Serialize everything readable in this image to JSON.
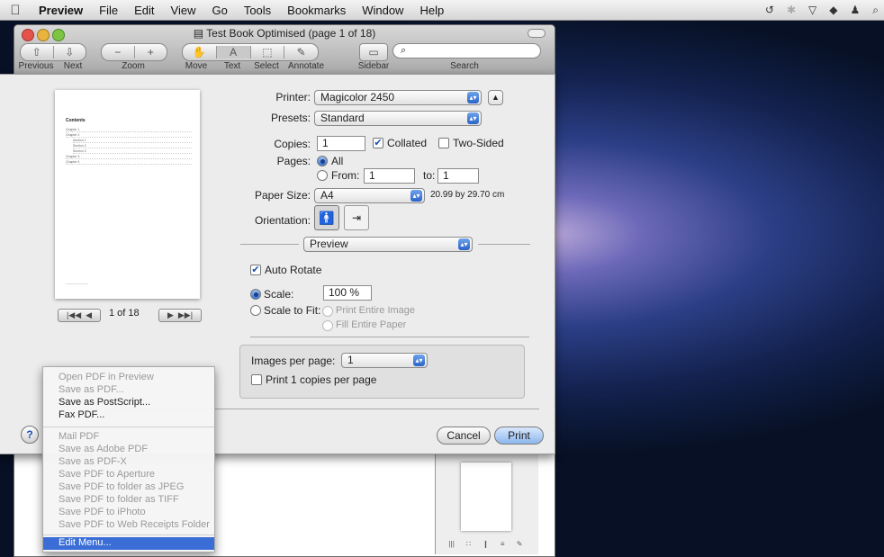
{
  "menubar": {
    "app": "Preview",
    "items": [
      "File",
      "Edit",
      "View",
      "Go",
      "Tools",
      "Bookmarks",
      "Window",
      "Help"
    ]
  },
  "window": {
    "title": "Test Book Optimised (page 1 of 18)"
  },
  "toolbar": {
    "labels": {
      "previous": "Previous",
      "next": "Next",
      "zoom": "Zoom",
      "move": "Move",
      "text": "Text",
      "select": "Select",
      "annotate": "Annotate",
      "sidebar": "Sidebar",
      "search": "Search"
    },
    "search_placeholder": ""
  },
  "preview": {
    "heading": "Contents",
    "toc": [
      "Chapter 1",
      "Chapter 2",
      "Section 1",
      "Section 2",
      "Section 3",
      "Chapter 3",
      "Chapter 4"
    ],
    "page_counter": "1 of 18"
  },
  "print": {
    "printer_label": "Printer:",
    "printer_value": "Magicolor 2450",
    "presets_label": "Presets:",
    "presets_value": "Standard",
    "copies_label": "Copies:",
    "copies_value": "1",
    "collated_label": "Collated",
    "two_sided_label": "Two-Sided",
    "pages_label": "Pages:",
    "all_label": "All",
    "from_label": "From:",
    "from_value": "1",
    "to_label": "to:",
    "to_value": "1",
    "paper_size_label": "Paper Size:",
    "paper_size_value": "A4",
    "paper_dims": "20.99 by 29.70 cm",
    "orientation_label": "Orientation:",
    "section_value": "Preview",
    "auto_rotate_label": "Auto Rotate",
    "scale_label": "Scale:",
    "scale_value": "100 %",
    "scale_to_fit_label": "Scale to Fit:",
    "print_entire_image": "Print Entire Image",
    "fill_entire_paper": "Fill Entire Paper",
    "images_per_page_label": "Images per page:",
    "images_per_page_value": "1",
    "print_copies_label": "Print 1 copies per page",
    "help_label": "?",
    "cancel_label": "Cancel",
    "print_label": "Print"
  },
  "pdf_menu": {
    "group1": [
      "Open PDF in Preview",
      "Save as PDF...",
      "Save as PostScript...",
      "Fax PDF..."
    ],
    "group2": [
      "Mail PDF",
      "Save as Adobe PDF",
      "Save as PDF-X",
      "Save PDF to Aperture",
      "Save PDF to folder as JPEG",
      "Save PDF to folder as TIFF",
      "Save PDF to iPhoto",
      "Save PDF to Web Receipts Folder"
    ],
    "edit": "Edit Menu..."
  },
  "colors": {
    "accent": "#3a6ed6",
    "print_button": "#a9c8f2"
  }
}
